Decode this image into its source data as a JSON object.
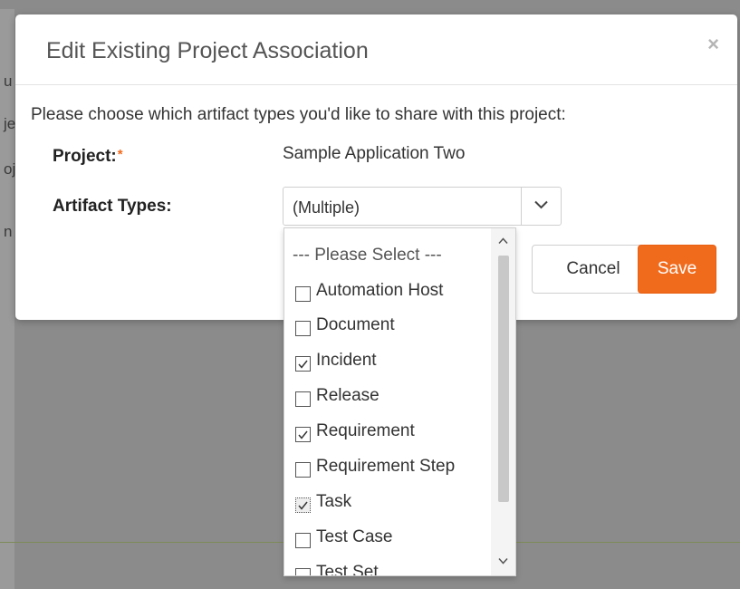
{
  "background": {
    "fragments": [
      "u",
      "je",
      "oj",
      "n"
    ]
  },
  "modal": {
    "title": "Edit Existing Project Association",
    "close_glyph": "×",
    "instruction": "Please choose which artifact types you'd like to share with this project:",
    "project_label": "Project:",
    "required_mark": "*",
    "project_value": "Sample Application Two",
    "artifact_label": "Artifact Types:",
    "artifact_select_value": "(Multiple)",
    "cancel_label": "Cancel",
    "save_label": "Save"
  },
  "dropdown": {
    "placeholder": "--- Please Select ---",
    "options": [
      {
        "label": "Automation Host",
        "checked": false
      },
      {
        "label": "Document",
        "checked": false
      },
      {
        "label": "Incident",
        "checked": true
      },
      {
        "label": "Release",
        "checked": false
      },
      {
        "label": "Requirement",
        "checked": true
      },
      {
        "label": "Requirement Step",
        "checked": false
      },
      {
        "label": "Task",
        "checked": true
      },
      {
        "label": "Test Case",
        "checked": false
      },
      {
        "label": "Test Set",
        "checked": false
      }
    ]
  },
  "colors": {
    "accent": "#f16b1d",
    "overlay": "#8b8b8b"
  }
}
